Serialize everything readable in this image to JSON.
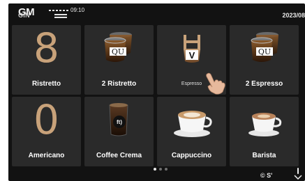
{
  "status": {
    "brand_top": "GM",
    "brand_bottom": "GIN",
    "time": "09:10",
    "date": "2023/08"
  },
  "tiles": [
    {
      "name": "ristretto",
      "label": "Ristretto",
      "symbol": "8",
      "icon": "big-digit-8"
    },
    {
      "name": "2-ristretto",
      "label": "2 Ristretto",
      "cup_text": "QU",
      "icon": "double-glass-cup-icon"
    },
    {
      "name": "espresso",
      "label": "Espresso",
      "cup_text": "V",
      "icon": "espresso-glass-icon"
    },
    {
      "name": "2-espresso",
      "label": "2 Espresso",
      "cup_text": "QU",
      "icon": "double-glass-cup-icon"
    },
    {
      "name": "americano",
      "label": "Americano",
      "symbol": "0",
      "icon": "big-digit-0"
    },
    {
      "name": "coffee-crema",
      "label": "Coffee Crema",
      "cup_text": "ft)",
      "icon": "tall-glass-icon"
    },
    {
      "name": "cappuccino",
      "label": "Cappuccino",
      "icon": "cappuccino-cup-icon"
    },
    {
      "name": "barista",
      "label": "Barista",
      "icon": "barista-cup-icon"
    }
  ],
  "pager": {
    "pages": 3,
    "active": 1
  },
  "footer": {
    "text": "© S'"
  },
  "colors": {
    "tile": "#2a2a2a",
    "screen": "#121212",
    "digit": "#c8a27a",
    "text": "#ffffff"
  }
}
